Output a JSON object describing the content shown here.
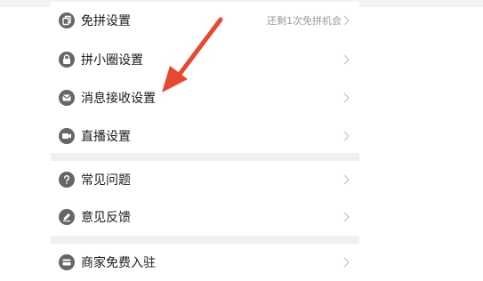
{
  "colors": {
    "icon": "#666666",
    "chevron": "#c8c8c8",
    "arrow": "#e8482f"
  },
  "group1": [
    {
      "label": "免拼设置",
      "hint": "还剩1次免拼机会",
      "icon": "copy-icon"
    },
    {
      "label": "拼小圈设置",
      "icon": "lock-icon"
    },
    {
      "label": "消息接收设置",
      "icon": "mail-icon"
    },
    {
      "label": "直播设置",
      "icon": "video-camera-icon"
    }
  ],
  "group2": [
    {
      "label": "常见问题",
      "icon": "question-icon"
    },
    {
      "label": "意见反馈",
      "icon": "edit-icon"
    }
  ],
  "group3": [
    {
      "label": "商家免费入驻",
      "icon": "card-icon"
    }
  ]
}
